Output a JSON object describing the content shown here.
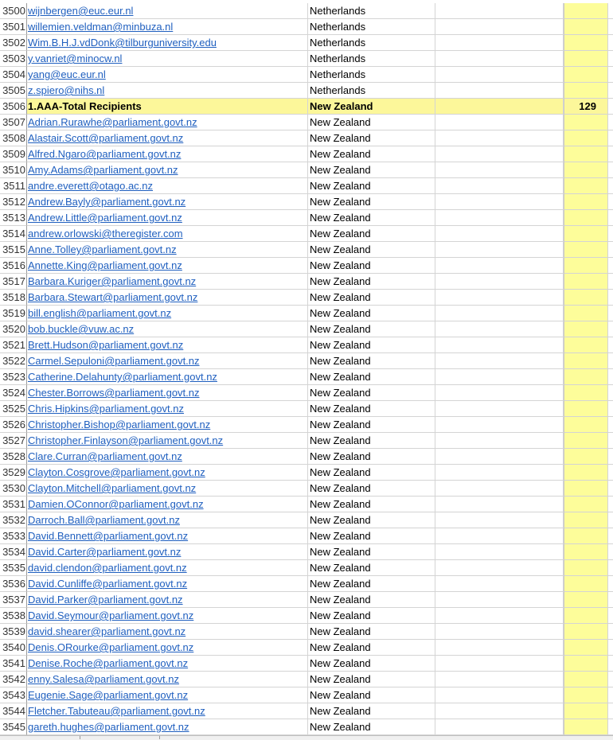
{
  "sheet": {
    "rows": [
      {
        "num": "3500",
        "email": "wijnbergen@euc.eur.nl",
        "country": "Netherlands"
      },
      {
        "num": "3501",
        "email": "willemien.veldman@minbuza.nl",
        "country": "Netherlands"
      },
      {
        "num": "3502",
        "email": "Wim.B.H.J.vdDonk@tilburguniversity.edu",
        "country": "Netherlands"
      },
      {
        "num": "3503",
        "email": "y.vanriet@minocw.nl",
        "country": "Netherlands"
      },
      {
        "num": "3504",
        "email": "yang@euc.eur.nl",
        "country": "Netherlands"
      },
      {
        "num": "3505",
        "email": "z.spiero@nihs.nl",
        "country": "Netherlands"
      },
      {
        "num": "3506",
        "email": "1.AAA-Total Recipients",
        "country": "New Zealand",
        "total": "129",
        "is_total": true
      },
      {
        "num": "3507",
        "email": "Adrian.Rurawhe@parliament.govt.nz",
        "country": "New Zealand"
      },
      {
        "num": "3508",
        "email": "Alastair.Scott@parliament.govt.nz",
        "country": "New Zealand"
      },
      {
        "num": "3509",
        "email": "Alfred.Ngaro@parliament.govt.nz",
        "country": "New Zealand"
      },
      {
        "num": "3510",
        "email": "Amy.Adams@parliament.govt.nz",
        "country": "New Zealand"
      },
      {
        "num": "3511",
        "email": "andre.everett@otago.ac.nz",
        "country": "New Zealand"
      },
      {
        "num": "3512",
        "email": "Andrew.Bayly@parliament.govt.nz",
        "country": "New Zealand"
      },
      {
        "num": "3513",
        "email": "Andrew.Little@parliament.govt.nz",
        "country": "New Zealand"
      },
      {
        "num": "3514",
        "email": "andrew.orlowski@theregister.com",
        "country": "New Zealand"
      },
      {
        "num": "3515",
        "email": "Anne.Tolley@parliament.govt.nz",
        "country": "New Zealand"
      },
      {
        "num": "3516",
        "email": "Annette.King@parliament.govt.nz",
        "country": "New Zealand"
      },
      {
        "num": "3517",
        "email": "Barbara.Kuriger@parliament.govt.nz",
        "country": "New Zealand"
      },
      {
        "num": "3518",
        "email": "Barbara.Stewart@parliament.govt.nz",
        "country": "New Zealand"
      },
      {
        "num": "3519",
        "email": "bill.english@parliament.govt.nz",
        "country": "New Zealand"
      },
      {
        "num": "3520",
        "email": "bob.buckle@vuw.ac.nz",
        "country": "New Zealand"
      },
      {
        "num": "3521",
        "email": "Brett.Hudson@parliament.govt.nz",
        "country": "New Zealand"
      },
      {
        "num": "3522",
        "email": "Carmel.Sepuloni@parliament.govt.nz",
        "country": "New Zealand"
      },
      {
        "num": "3523",
        "email": "Catherine.Delahunty@parliament.govt.nz",
        "country": "New Zealand"
      },
      {
        "num": "3524",
        "email": "Chester.Borrows@parliament.govt.nz",
        "country": "New Zealand"
      },
      {
        "num": "3525",
        "email": "Chris.Hipkins@parliament.govt.nz",
        "country": "New Zealand"
      },
      {
        "num": "3526",
        "email": "Christopher.Bishop@parliament.govt.nz",
        "country": "New Zealand"
      },
      {
        "num": "3527",
        "email": "Christopher.Finlayson@parliament.govt.nz",
        "country": "New Zealand"
      },
      {
        "num": "3528",
        "email": "Clare.Curran@parliament.govt.nz",
        "country": "New Zealand"
      },
      {
        "num": "3529",
        "email": "Clayton.Cosgrove@parliament.govt.nz",
        "country": "New Zealand"
      },
      {
        "num": "3530",
        "email": "Clayton.Mitchell@parliament.govt.nz",
        "country": "New Zealand"
      },
      {
        "num": "3531",
        "email": "Damien.OConnor@parliament.govt.nz",
        "country": "New Zealand"
      },
      {
        "num": "3532",
        "email": "Darroch.Ball@parliament.govt.nz",
        "country": "New Zealand"
      },
      {
        "num": "3533",
        "email": "David.Bennett@parliament.govt.nz",
        "country": "New Zealand"
      },
      {
        "num": "3534",
        "email": "David.Carter@parliament.govt.nz",
        "country": "New Zealand"
      },
      {
        "num": "3535",
        "email": "david.clendon@parliament.govt.nz",
        "country": "New Zealand"
      },
      {
        "num": "3536",
        "email": "David.Cunliffe@parliament.govt.nz",
        "country": "New Zealand"
      },
      {
        "num": "3537",
        "email": "David.Parker@parliament.govt.nz",
        "country": "New Zealand"
      },
      {
        "num": "3538",
        "email": "David.Seymour@parliament.govt.nz",
        "country": "New Zealand"
      },
      {
        "num": "3539",
        "email": "david.shearer@parliament.govt.nz",
        "country": "New Zealand"
      },
      {
        "num": "3540",
        "email": "Denis.ORourke@parliament.govt.nz",
        "country": "New Zealand"
      },
      {
        "num": "3541",
        "email": "Denise.Roche@parliament.govt.nz",
        "country": "New Zealand"
      },
      {
        "num": "3542",
        "email": "enny.Salesa@parliament.govt.nz",
        "country": "New Zealand"
      },
      {
        "num": "3543",
        "email": "Eugenie.Sage@parliament.govt.nz",
        "country": "New Zealand"
      },
      {
        "num": "3544",
        "email": "Fletcher.Tabuteau@parliament.govt.nz",
        "country": "New Zealand"
      },
      {
        "num": "3545",
        "email": "gareth.hughes@parliament.govt.nz",
        "country": "New Zealand"
      }
    ]
  },
  "colors": {
    "link": "#1f5fbf",
    "highlight": "#fdfd9a",
    "gridline": "#d4d4d4"
  }
}
